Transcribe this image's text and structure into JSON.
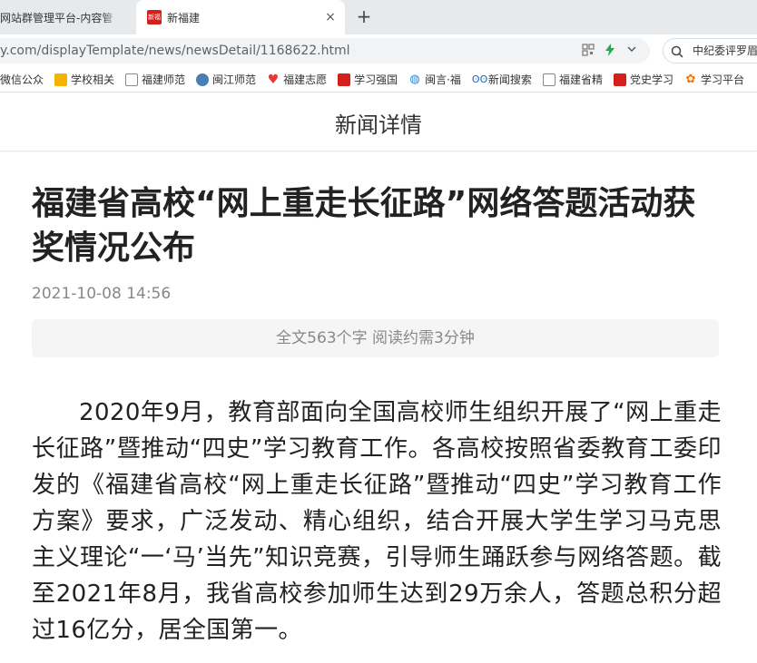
{
  "browser": {
    "tabs": [
      {
        "label": "网站群管理平台-内容管",
        "active": false
      },
      {
        "label": "新福建",
        "active": true,
        "favicon_text": "新福建"
      }
    ],
    "new_tab_symbol": "+",
    "close_symbol": "×",
    "url": "y.com/displayTemplate/news/newsDetail/1168622.html",
    "search_text": "中纪委评罗眉",
    "bookmarks": [
      {
        "label": "微信公众",
        "icon": "wechat-icon"
      },
      {
        "label": "学校相关",
        "icon": "folder-icon"
      },
      {
        "label": "福建师范",
        "icon": "document-icon"
      },
      {
        "label": "闽江师范",
        "icon": "globe-icon"
      },
      {
        "label": "福建志愿",
        "icon": "heart-icon"
      },
      {
        "label": "学习强国",
        "icon": "xuexi-icon"
      },
      {
        "label": "闽言·福",
        "icon": "drop-icon"
      },
      {
        "label": "新闻搜索",
        "icon": "owl-icon"
      },
      {
        "label": "福建省精",
        "icon": "document-icon"
      },
      {
        "label": "党史学习",
        "icon": "xuexi-icon"
      },
      {
        "label": "学习平台",
        "icon": "star-icon"
      }
    ]
  },
  "page": {
    "header_title": "新闻详情",
    "article": {
      "title": "福建省高校“网上重走长征路”网络答题活动获奖情况公布",
      "date": "2021-10-08 14:56",
      "word_count": "全文563个字 阅读约需3分钟",
      "body": "2020年9月，教育部面向全国高校师生组织开展了“网上重走长征路”暨推动“四史”学习教育工作。各高校按照省委教育工委印发的《福建省高校“网上重走长征路”暨推动“四史”学习教育工作方案》要求，广泛发动、精心组织，结合开展大学生学习马克思主义理论“一‘马’当先”知识竞赛，引导师生踊跃参与网络答题。截至2021年8月，我省高校参加师生达到29万余人，答题总积分超过16亿分，居全国第一。"
    }
  },
  "colors": {
    "tabstrip_bg": "#e7eaed",
    "omnibox_bg": "#f1f3f4",
    "brand_red": "#d4201c",
    "title_text": "#222222",
    "meta_text": "#888888"
  }
}
